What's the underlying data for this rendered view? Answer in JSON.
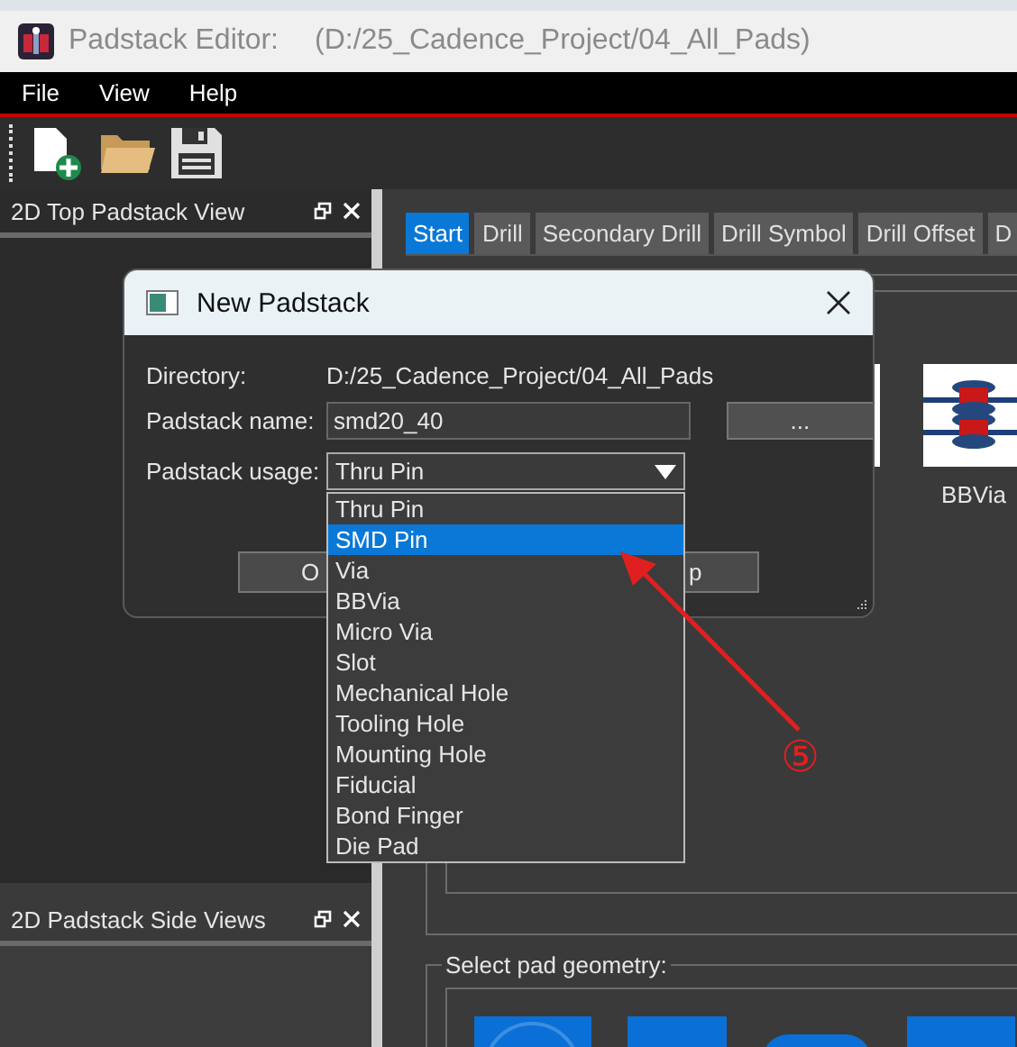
{
  "window": {
    "title": "Padstack Editor:",
    "path": "(D:/25_Cadence_Project/04_All_Pads)"
  },
  "menu": [
    "File",
    "View",
    "Help"
  ],
  "docks": [
    {
      "title": "2D Top Padstack View"
    },
    {
      "title": "2D Padstack Side Views"
    }
  ],
  "tabs": [
    {
      "label": "Start",
      "selected": true
    },
    {
      "label": "Drill",
      "selected": false
    },
    {
      "label": "Secondary Drill",
      "selected": false
    },
    {
      "label": "Drill Symbol",
      "selected": false
    },
    {
      "label": "Drill Offset",
      "selected": false
    },
    {
      "label": "D",
      "selected": false
    }
  ],
  "preview": {
    "label": "BBVia"
  },
  "geometry_group": {
    "title": "Select pad geometry:"
  },
  "dialog": {
    "title": "New Padstack",
    "directory_label": "Directory:",
    "directory": "D:/25_Cadence_Project/04_All_Pads",
    "name_label": "Padstack name:",
    "name_value": "smd20_40",
    "browse_button": "...",
    "usage_label": "Padstack usage:",
    "usage_value": "Thru Pin",
    "buttons": [
      "O",
      "p"
    ]
  },
  "dropdown": {
    "options": [
      {
        "label": "Thru Pin",
        "selected": false
      },
      {
        "label": "SMD Pin",
        "selected": true
      },
      {
        "label": "Via",
        "selected": false
      },
      {
        "label": "BBVia",
        "selected": false
      },
      {
        "label": "Micro Via",
        "selected": false
      },
      {
        "label": "Slot",
        "selected": false
      },
      {
        "label": "Mechanical Hole",
        "selected": false
      },
      {
        "label": "Tooling Hole",
        "selected": false
      },
      {
        "label": "Mounting Hole",
        "selected": false
      },
      {
        "label": "Fiducial",
        "selected": false
      },
      {
        "label": "Bond Finger",
        "selected": false
      },
      {
        "label": "Die Pad",
        "selected": false
      }
    ]
  },
  "annotation": {
    "marker": "⑤"
  }
}
